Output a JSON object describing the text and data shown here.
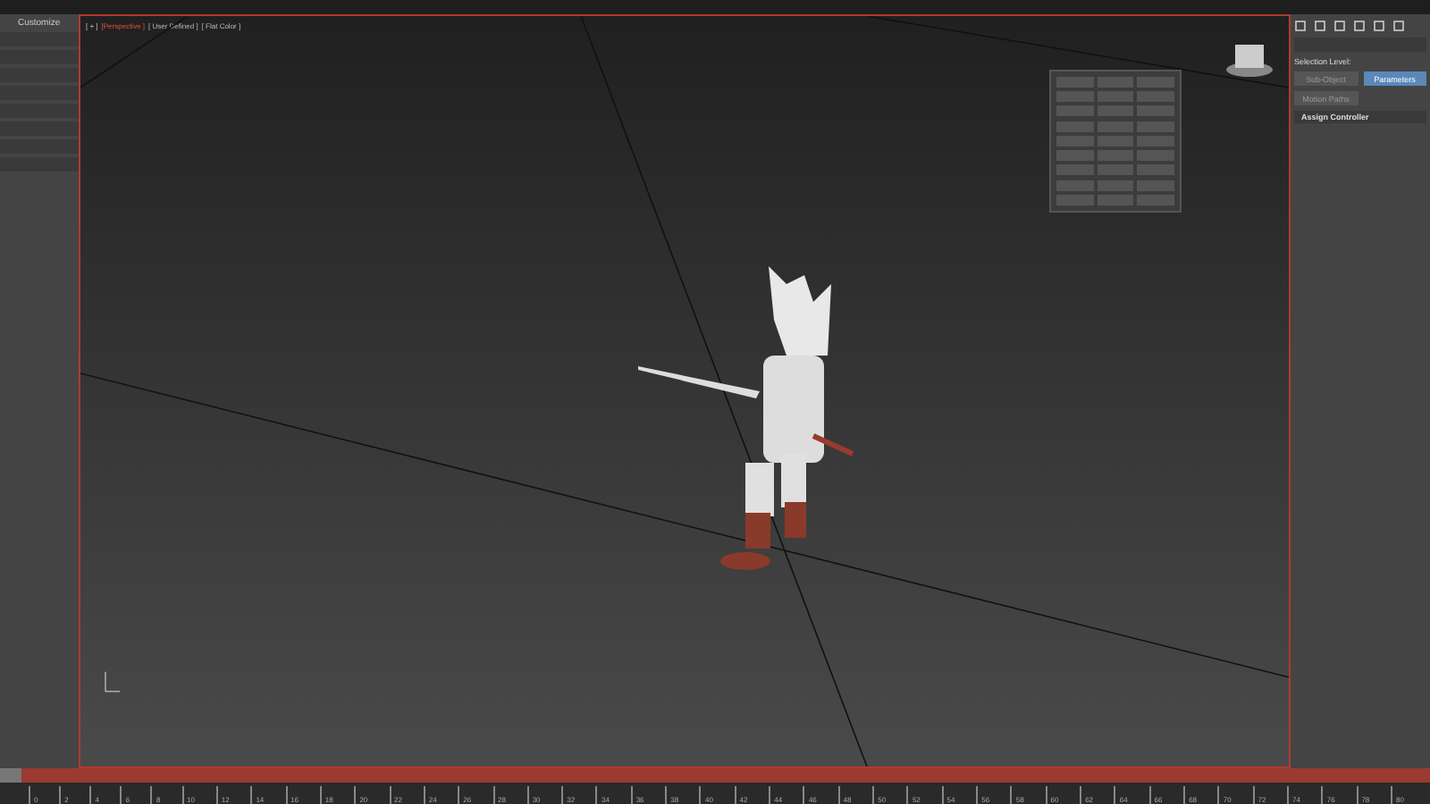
{
  "left_panel": {
    "menu_label": "Customize"
  },
  "viewport": {
    "labels": [
      "[ + ]",
      "[Perspective ]",
      "[ User Defined ]",
      "[ Flat Color ]"
    ]
  },
  "right_panel": {
    "selection_label": "Selection Level:",
    "buttons": [
      {
        "label": "Sub-Object",
        "selected": false
      },
      {
        "label": "Parameters",
        "selected": true
      },
      {
        "label": "Motion Paths",
        "selected": false
      }
    ],
    "rollout": "Assign Controller"
  },
  "timeline": {
    "slider": {
      "level": 0
    },
    "ticks": [
      "0",
      "2",
      "4",
      "6",
      "8",
      "10",
      "12",
      "14",
      "16",
      "18",
      "20",
      "22",
      "24",
      "26",
      "28",
      "30",
      "32",
      "34",
      "36",
      "38",
      "40",
      "42",
      "44",
      "46",
      "48",
      "50",
      "52",
      "54",
      "56",
      "58",
      "60",
      "62",
      "64",
      "66",
      "68",
      "70",
      "72",
      "74",
      "76",
      "78",
      "80"
    ]
  }
}
